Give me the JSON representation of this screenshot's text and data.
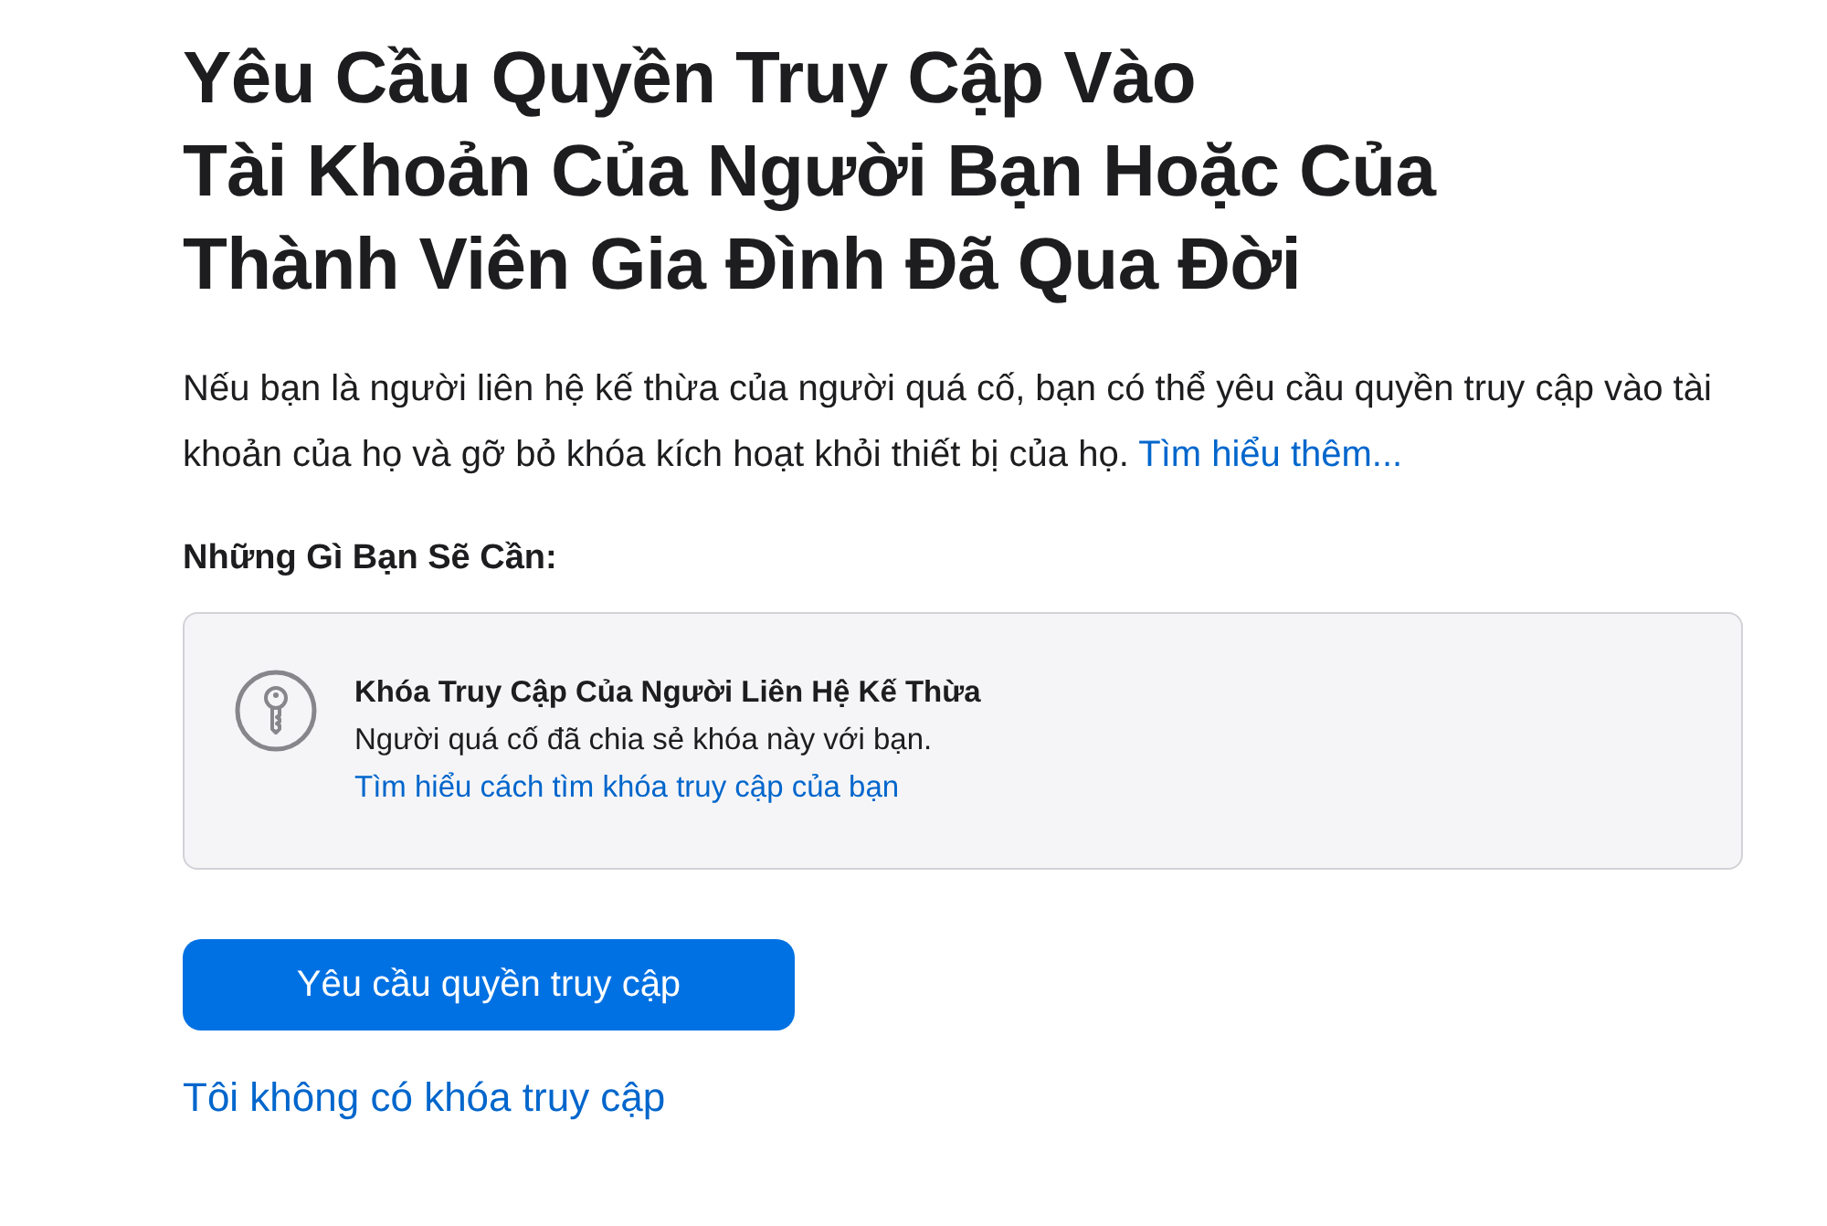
{
  "title_lines": [
    "Yêu Cầu Quyền Truy Cập Vào",
    "Tài Khoản Của Người Bạn Hoặc Của",
    "Thành Viên Gia Đình Đã Qua Đời"
  ],
  "intro": {
    "text": "Nếu bạn là người liên hệ kế thừa của người quá cố, bạn có thể yêu cầu quyền truy cập vào tài khoản của họ và gỡ bỏ khóa kích hoạt khỏi thiết bị của họ.",
    "link": "Tìm hiểu thêm..."
  },
  "needs_heading": "Những Gì Bạn Sẽ Cần:",
  "requirement": {
    "title": "Khóa Truy Cập Của Người Liên Hệ Kế Thừa",
    "description": "Người quá cố đã chia sẻ khóa này với bạn.",
    "link": "Tìm hiểu cách tìm khóa truy cập của bạn"
  },
  "primary_button": "Yêu cầu quyền truy cập",
  "secondary_link": "Tôi không có khóa truy cập"
}
